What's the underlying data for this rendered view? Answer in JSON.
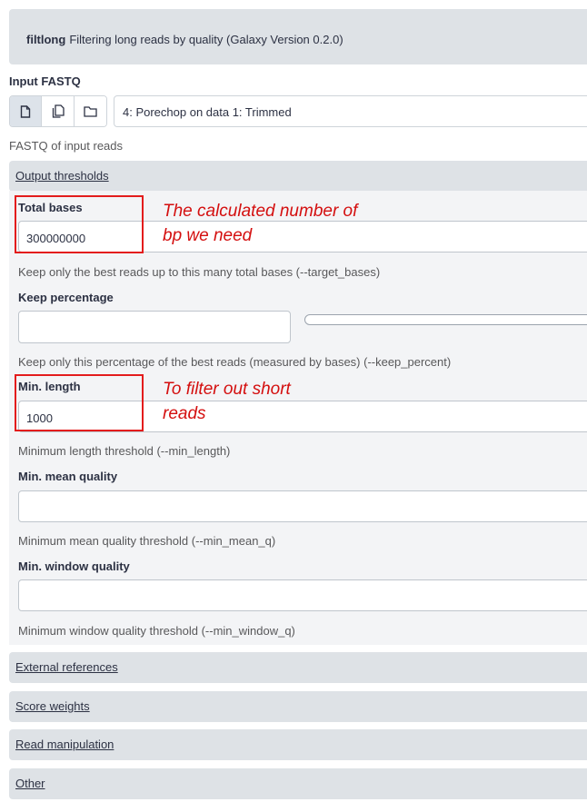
{
  "tool": {
    "name": "filtlong",
    "description": "Filtering long reads by quality (Galaxy Version 0.2.0)"
  },
  "input_fastq": {
    "label": "Input FASTQ",
    "selected": "4: Porechop on data 1: Trimmed",
    "help": "FASTQ of input reads",
    "buttons": [
      "file-icon",
      "files-icon",
      "folder-icon"
    ]
  },
  "output_thresholds": {
    "title": "Output thresholds",
    "total_bases": {
      "label": "Total bases",
      "value": "300000000",
      "help": "Keep only the best reads up to this many total bases (--target_bases)"
    },
    "keep_percentage": {
      "label": "Keep percentage",
      "value": "",
      "help": "Keep only this percentage of the best reads (measured by bases) (--keep_percent)"
    },
    "min_length": {
      "label": "Min. length",
      "value": "1000",
      "help": "Minimum length threshold (--min_length)"
    },
    "min_mean_quality": {
      "label": "Min. mean quality",
      "value": "",
      "help": "Minimum mean quality threshold (--min_mean_q)"
    },
    "min_window_quality": {
      "label": "Min. window quality",
      "value": "",
      "help": "Minimum window quality threshold (--min_window_q)"
    }
  },
  "annotations": {
    "total_bases_note": "The calculated number of\nbp we need",
    "min_length_note": "To filter out short\nreads"
  },
  "sections": {
    "external_references": "External references",
    "score_weights": "Score weights",
    "read_manipulation": "Read manipulation",
    "other": "Other"
  },
  "colors": {
    "annotation_red": "#e31c1c",
    "section_bg": "#dee2e6"
  }
}
